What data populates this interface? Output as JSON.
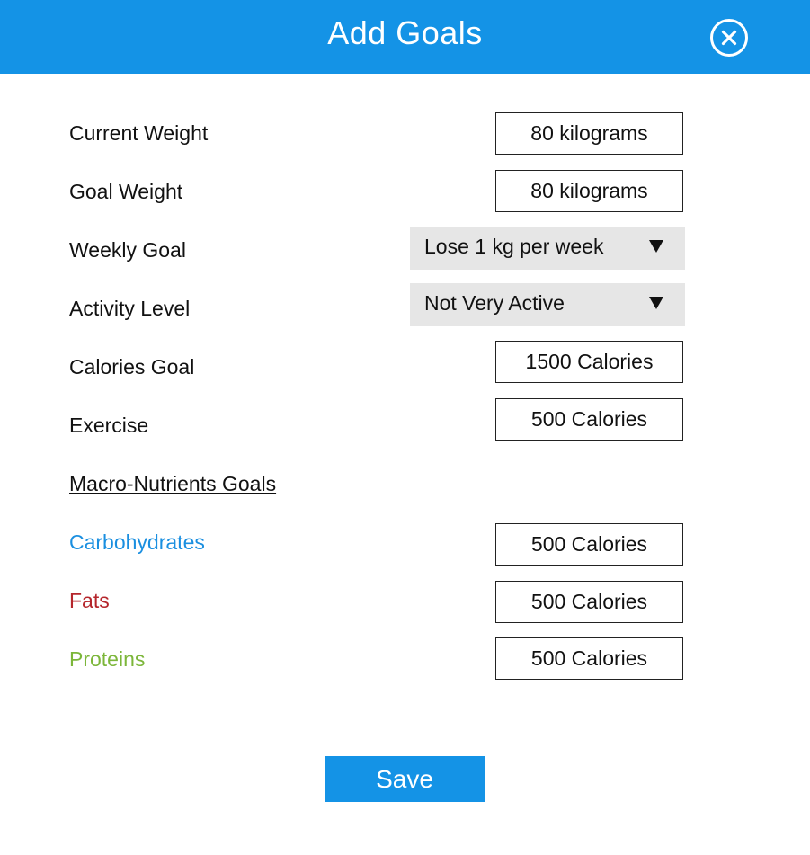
{
  "header": {
    "title": "Add Goals",
    "close_icon": "close-circle-icon"
  },
  "form": {
    "current_weight": {
      "label": "Current Weight",
      "value": "80 kilograms"
    },
    "goal_weight": {
      "label": "Goal Weight",
      "value": "80 kilograms"
    },
    "weekly_goal": {
      "label": "Weekly Goal",
      "value": "Lose 1 kg per week",
      "arrow_icon": "dropdown-arrow-icon"
    },
    "activity_level": {
      "label": "Activity Level",
      "value": "Not Very Active",
      "arrow_icon": "dropdown-arrow-icon"
    },
    "calories_goal": {
      "label": "Calories Goal",
      "value": "1500 Calories"
    },
    "exercise": {
      "label": "Exercise",
      "value": "500 Calories"
    }
  },
  "macros": {
    "title": "Macro-Nutrients Goals",
    "carbohydrates": {
      "label": "Carbohydrates",
      "value": "500 Calories",
      "color": "#1a8fe0"
    },
    "fats": {
      "label": "Fats",
      "value": "500 Calories",
      "color": "#b5262c"
    },
    "proteins": {
      "label": "Proteins",
      "value": "500 Calories",
      "color": "#7cb63a"
    }
  },
  "actions": {
    "save_label": "Save"
  },
  "colors": {
    "accent": "#1493e6",
    "select_bg": "#e6e6e6"
  }
}
